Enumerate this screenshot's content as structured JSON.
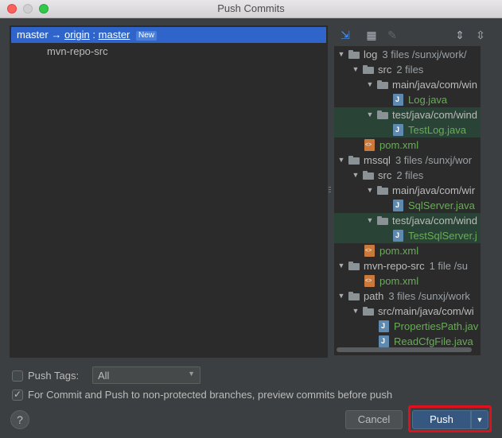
{
  "window": {
    "title": "Push Commits"
  },
  "branch": {
    "local": "master",
    "arrow": "→",
    "remote": "origin",
    "separator": ":",
    "target": "master",
    "badge": "New"
  },
  "repos": [
    "mvn-repo-src"
  ],
  "tree": [
    {
      "level": 0,
      "type": "module",
      "name": "log",
      "meta": "3 files  /sunxj/work/",
      "expanded": true
    },
    {
      "level": 1,
      "type": "folder",
      "name": "src",
      "meta": "2 files",
      "expanded": true
    },
    {
      "level": 2,
      "type": "folder",
      "name": "main/java/com/win",
      "meta": "",
      "expanded": true
    },
    {
      "level": 3,
      "type": "java",
      "name": "Log.java",
      "meta": ""
    },
    {
      "level": 2,
      "type": "folder",
      "name": "test/java/com/wind",
      "meta": "",
      "expanded": true,
      "highlight": true
    },
    {
      "level": 3,
      "type": "java",
      "name": "TestLog.java",
      "meta": "",
      "highlight": true
    },
    {
      "level": 1,
      "type": "xml",
      "name": "pom.xml",
      "meta": ""
    },
    {
      "level": 0,
      "type": "module",
      "name": "mssql",
      "meta": "3 files  /sunxj/wor",
      "expanded": true
    },
    {
      "level": 1,
      "type": "folder",
      "name": "src",
      "meta": "2 files",
      "expanded": true
    },
    {
      "level": 2,
      "type": "folder",
      "name": "main/java/com/wir",
      "meta": "",
      "expanded": true
    },
    {
      "level": 3,
      "type": "java",
      "name": "SqlServer.java",
      "meta": ""
    },
    {
      "level": 2,
      "type": "folder",
      "name": "test/java/com/wind",
      "meta": "",
      "expanded": true,
      "highlight": true
    },
    {
      "level": 3,
      "type": "java",
      "name": "TestSqlServer.j",
      "meta": "",
      "highlight": true
    },
    {
      "level": 1,
      "type": "xml",
      "name": "pom.xml",
      "meta": ""
    },
    {
      "level": 0,
      "type": "module",
      "name": "mvn-repo-src",
      "meta": "1 file  /su",
      "expanded": true
    },
    {
      "level": 1,
      "type": "xml",
      "name": "pom.xml",
      "meta": ""
    },
    {
      "level": 0,
      "type": "module",
      "name": "path",
      "meta": "3 files  /sunxj/work",
      "expanded": true
    },
    {
      "level": 1,
      "type": "folder",
      "name": "src/main/java/com/wi",
      "meta": "",
      "expanded": true
    },
    {
      "level": 2,
      "type": "java",
      "name": "PropertiesPath.jav",
      "meta": ""
    },
    {
      "level": 2,
      "type": "java",
      "name": "ReadCfgFile.java",
      "meta": ""
    }
  ],
  "options": {
    "push_tags_label": "Push Tags:",
    "push_tags_checked": false,
    "tags_value": "All",
    "preview_label": "For Commit and Push to non-protected branches, preview commits before push",
    "preview_checked": true
  },
  "buttons": {
    "help": "?",
    "cancel": "Cancel",
    "push": "Push",
    "push_dropdown": "▼"
  },
  "icons": {
    "toolbar": [
      "expand-all-icon",
      "group-by-icon",
      "edit-icon",
      "expand-icon",
      "collapse-icon"
    ]
  },
  "colors": {
    "accent": "#2f65ca",
    "highlight_row": "#294436",
    "file_green": "#6aab5a",
    "push_outline": "#e0111e"
  }
}
